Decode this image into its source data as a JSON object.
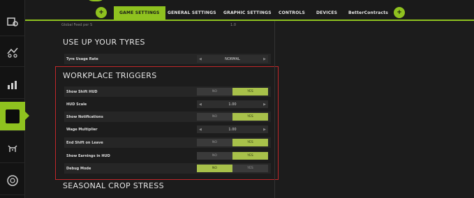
{
  "topbar": {
    "left_button": "+",
    "right_button": "+",
    "tabs": [
      {
        "label": "GAME SETTINGS",
        "active": true
      },
      {
        "label": "GENERAL SETTINGS",
        "active": false
      },
      {
        "label": "GRAPHIC SETTINGS",
        "active": false
      },
      {
        "label": "CONTROLS",
        "active": false
      },
      {
        "label": "DEVICES",
        "active": false
      },
      {
        "label": "BetterContracts",
        "active": false
      }
    ]
  },
  "sidebar": {
    "icons": [
      "calendar-sun-icon",
      "tractor-icon",
      "chart-bars-icon",
      "settings-active-icon",
      "cow-icon",
      "help-circle-icon"
    ],
    "accent": "#8fc21f"
  },
  "partial_row": {
    "label": "Global Feed per S",
    "value": "1.0"
  },
  "tyres": {
    "title": "USE UP YOUR TYRES",
    "rows": [
      {
        "label": "Tyre Usage Rate",
        "value": "NORMAL"
      }
    ]
  },
  "workplace": {
    "title": "WORKPLACE TRIGGERS",
    "rows": [
      {
        "label": "Show Shift HUD",
        "type": "toggle",
        "off": "NO",
        "on": "YES",
        "selected": "on"
      },
      {
        "label": "HUD Scale",
        "type": "select",
        "value": "1.00"
      },
      {
        "label": "Show Notifications",
        "type": "toggle",
        "off": "NO",
        "on": "YES",
        "selected": "on"
      },
      {
        "label": "Wage Multiplier",
        "type": "select",
        "value": "1.00"
      },
      {
        "label": "End Shift on Leave",
        "type": "toggle",
        "off": "NO",
        "on": "YES",
        "selected": "on"
      },
      {
        "label": "Show Earnings in HUD",
        "type": "toggle",
        "off": "NO",
        "on": "YES",
        "selected": "on"
      },
      {
        "label": "Debug Mode",
        "type": "toggle",
        "off": "NO",
        "on": "YES",
        "selected": "off"
      }
    ]
  },
  "seasonal": {
    "title": "SEASONAL CROP STRESS"
  },
  "colors": {
    "highlight_box": "#c0282a",
    "toggle_on": "#a8c14a"
  }
}
